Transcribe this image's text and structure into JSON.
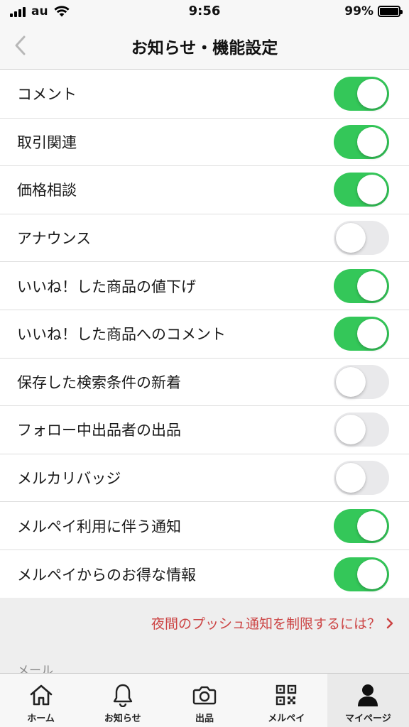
{
  "status_bar": {
    "carrier": "au",
    "time": "9:56",
    "battery": "99%"
  },
  "nav": {
    "title": "お知らせ・機能設定"
  },
  "settings": [
    {
      "label": "コメント",
      "enabled": true
    },
    {
      "label": "取引関連",
      "enabled": true
    },
    {
      "label": "価格相談",
      "enabled": true
    },
    {
      "label": "アナウンス",
      "enabled": false
    },
    {
      "label": "いいね！した商品の値下げ",
      "enabled": true
    },
    {
      "label": "いいね！した商品へのコメント",
      "enabled": true
    },
    {
      "label": "保存した検索条件の新着",
      "enabled": false
    },
    {
      "label": "フォロー中出品者の出品",
      "enabled": false
    },
    {
      "label": "メルカリバッジ",
      "enabled": false
    },
    {
      "label": "メルペイ利用に伴う通知",
      "enabled": true
    },
    {
      "label": "メルペイからのお得な情報",
      "enabled": true
    }
  ],
  "night_push_link": "夜間のプッシュ通知を制限するには？",
  "mail_section_header": "メール",
  "tab_bar": {
    "tabs": [
      {
        "label": "ホーム",
        "icon": "home-icon"
      },
      {
        "label": "お知らせ",
        "icon": "bell-icon"
      },
      {
        "label": "出品",
        "icon": "camera-icon"
      },
      {
        "label": "メルペイ",
        "icon": "qr-code-icon"
      },
      {
        "label": "マイページ",
        "icon": "person-icon"
      }
    ],
    "active_index": 4
  },
  "colors": {
    "toggle_on": "#34c759",
    "toggle_off": "#e9e9eb",
    "link": "#cc4444",
    "section_background": "#eeeeee"
  }
}
